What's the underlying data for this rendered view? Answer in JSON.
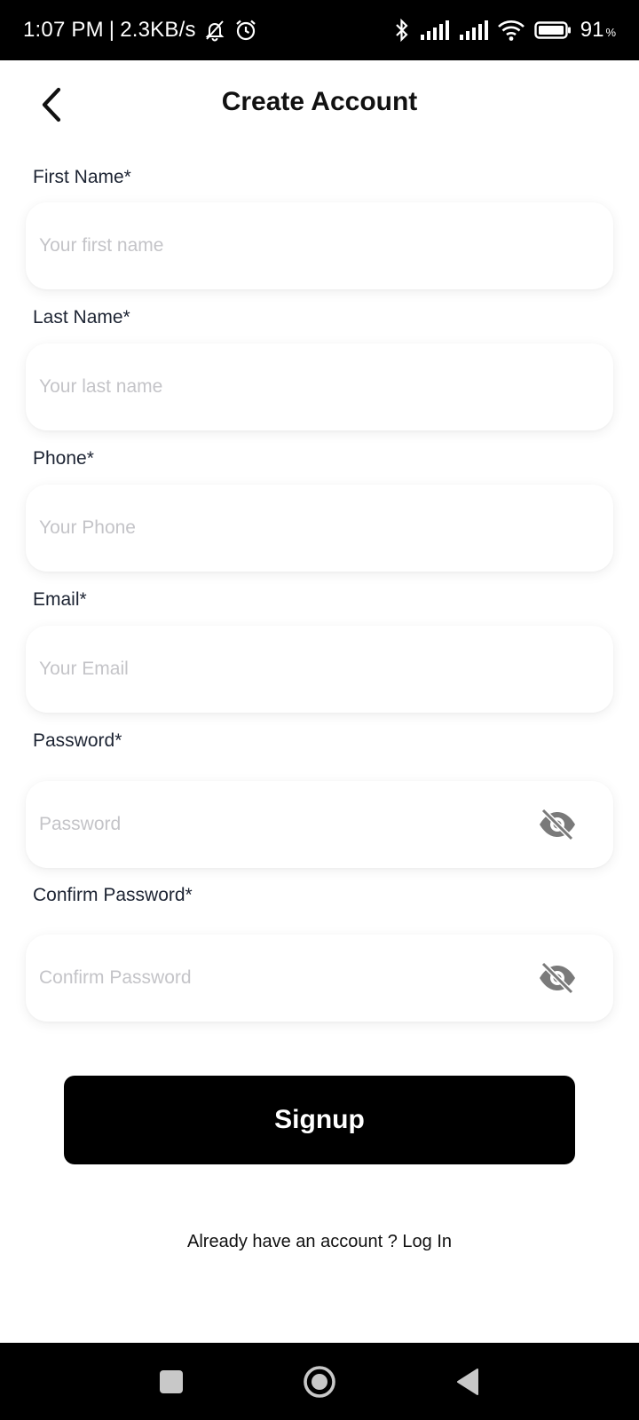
{
  "status_bar": {
    "time": "1:07 PM",
    "separator": "|",
    "speed": "2.3KB/s",
    "icons": [
      "mute-bell-icon",
      "alarm-icon",
      "bluetooth-icon",
      "signal-icon",
      "signal-icon",
      "wifi-icon",
      "battery-icon"
    ],
    "battery": "91",
    "battery_unit": "%"
  },
  "header": {
    "title": "Create Account",
    "back_icon": "chevron-left-icon"
  },
  "form": {
    "first_name": {
      "label": "First Name*",
      "placeholder": "Your first name",
      "value": ""
    },
    "last_name": {
      "label": "Last Name*",
      "placeholder": "Your last name",
      "value": ""
    },
    "phone": {
      "label": "Phone*",
      "placeholder": "Your Phone",
      "value": ""
    },
    "email": {
      "label": "Email*",
      "placeholder": "Your Email",
      "value": ""
    },
    "password": {
      "label": "Password*",
      "placeholder": "Password",
      "value": "",
      "toggle_icon": "eye-off-icon"
    },
    "confirm_password": {
      "label": "Confirm Password*",
      "placeholder": "Confirm Password",
      "value": "",
      "toggle_icon": "eye-off-icon"
    }
  },
  "signup_button": {
    "label": "Signup"
  },
  "login_prompt": {
    "text": "Already have an account ?",
    "link": "Log In"
  },
  "nav_bar": {
    "buttons": [
      "recents-square-icon",
      "home-circle-icon",
      "back-triangle-icon"
    ]
  },
  "colors": {
    "status_bar_bg": "#000000",
    "button_bg": "#000000",
    "placeholder": "#c4c4c8",
    "label_text": "#1d2433",
    "icon_gray": "#7a7a7a"
  }
}
